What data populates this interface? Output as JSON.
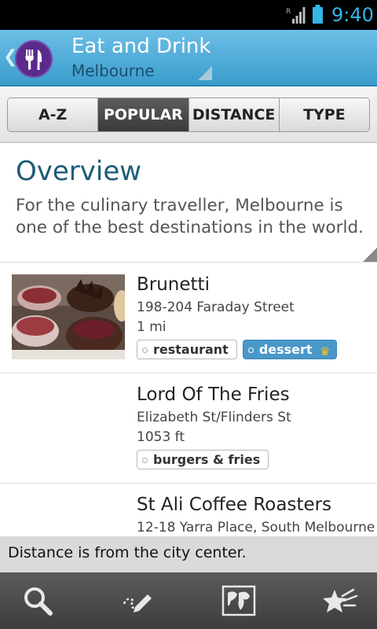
{
  "status_bar": {
    "time": "9:40",
    "icons": [
      "signal-icon",
      "battery-icon"
    ],
    "accent_color": "#33b5e5"
  },
  "action_bar": {
    "title": "Eat and Drink",
    "subtitle": "Melbourne",
    "app_icon": "fork-knife-icon",
    "colors": {
      "background": "#4fa9d6",
      "icon_bg": "#5a2a8c"
    }
  },
  "tabs": [
    {
      "label": "A-Z",
      "active": false
    },
    {
      "label": "POPULAR",
      "active": true
    },
    {
      "label": "DISTANCE",
      "active": false
    },
    {
      "label": "TYPE",
      "active": false
    }
  ],
  "overview": {
    "heading": "Overview",
    "text": "For the culinary traveller, Melbourne is one of the best destinations in the world."
  },
  "listings": [
    {
      "name": "Brunetti",
      "address": "198-204 Faraday Street",
      "distance": "1 mi",
      "has_photo": true,
      "tags": [
        {
          "label": "restaurant",
          "premium": false
        },
        {
          "label": "dessert",
          "premium": true
        }
      ]
    },
    {
      "name": "Lord Of The Fries",
      "address": "Elizabeth St/Flinders St",
      "distance": "1053 ft",
      "has_photo": false,
      "tags": [
        {
          "label": "burgers & fries",
          "premium": false
        }
      ]
    },
    {
      "name": "St Ali Coffee Roasters",
      "address": "12-18 Yarra Place, South Melbourne",
      "has_photo": false
    }
  ],
  "notice": "Distance is from the city center.",
  "bottom_bar": {
    "icons": [
      "search-icon",
      "write-review-icon",
      "map-icon",
      "favorites-icon"
    ]
  }
}
